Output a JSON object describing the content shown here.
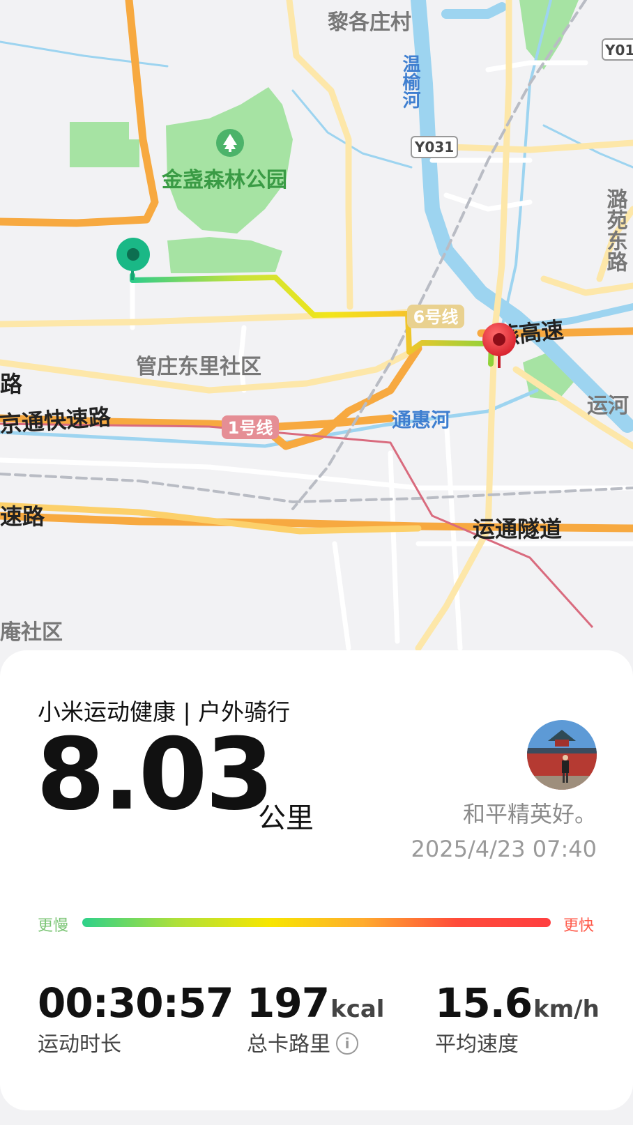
{
  "map": {
    "labels": {
      "village_north": "黎各庄村",
      "river_wenyu": "温榆河",
      "road_y031": "Y031",
      "road_y01": "Y01",
      "park": "金盏森林公园",
      "line6": "6号线",
      "expressway_jingyan": "燕高速",
      "community_guanzhuang": "管庄东里社区",
      "road_partial_left": "路",
      "jingtong_expressway": "京通快速路",
      "line1": "1号线",
      "tonghui_river": "通惠河",
      "grand_canal": "运河",
      "road_lu_yuan": "潞苑东路",
      "expressway_left": "速路",
      "yuntong_tunnel": "运通隧道",
      "community_bottom_left": "庵社区"
    },
    "colors": {
      "start_marker": "#1ab886",
      "end_marker": "#e8323c",
      "highway": "#f7a940",
      "water": "#9dd4f0",
      "park": "#a6e3a3"
    }
  },
  "card": {
    "title": "小米运动健康 | 户外骑行",
    "distance": "8.03",
    "distance_unit": "公里",
    "user_name": "和平精英好。",
    "timestamp": "2025/4/23 07:40",
    "speed_legend": {
      "slow": "更慢",
      "fast": "更快",
      "gradient": [
        "#2ed18a",
        "#aee03a",
        "#f7e600",
        "#ffab2e",
        "#ff4b3a",
        "#ff3f40"
      ]
    },
    "stats": [
      {
        "value": "00:30:57",
        "unit": "",
        "label": "运动时长"
      },
      {
        "value": "197",
        "unit": "kcal",
        "label": "总卡路里",
        "info_icon": "i"
      },
      {
        "value": "15.6",
        "unit": "km/h",
        "label": "平均速度"
      }
    ]
  }
}
